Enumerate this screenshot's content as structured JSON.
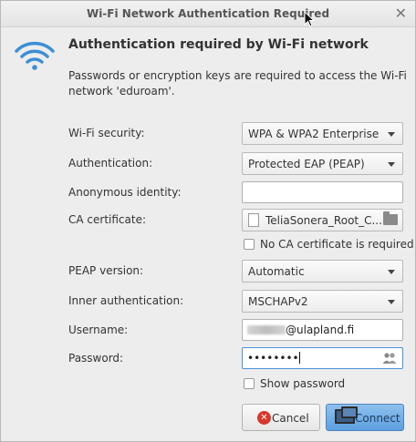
{
  "window": {
    "title": "Wi-Fi Network Authentication Required"
  },
  "header": {
    "heading": "Authentication required by Wi-Fi network",
    "description": "Passwords or encryption keys are required to access the Wi-Fi network 'eduroam'."
  },
  "form": {
    "wifi_security": {
      "label": "Wi-Fi security:",
      "value": "WPA & WPA2 Enterprise"
    },
    "authentication": {
      "label": "Authentication:",
      "value": "Protected EAP (PEAP)"
    },
    "anonymous_identity": {
      "label": "Anonymous identity:",
      "value": ""
    },
    "ca_certificate": {
      "label": "CA certificate:",
      "value": "TeliaSonera_Root_C..."
    },
    "no_ca_required": {
      "label": "No CA certificate is required",
      "checked": false
    },
    "peap_version": {
      "label": "PEAP version:",
      "value": "Automatic"
    },
    "inner_authentication": {
      "label": "Inner authentication:",
      "value": "MSCHAPv2"
    },
    "username": {
      "label": "Username:",
      "value_suffix": "@ulapland.fi"
    },
    "password": {
      "label": "Password:",
      "value": "••••••••"
    },
    "show_password": {
      "label": "Show password",
      "checked": false
    }
  },
  "buttons": {
    "cancel": "Cancel",
    "connect": "Connect"
  },
  "icons": {
    "wifi": "wifi-icon",
    "close": "close-icon",
    "users": "users-icon",
    "folder": "folder-icon"
  },
  "colors": {
    "accent": "#4a90d9",
    "wifi": "#3b8fd6",
    "cancel": "#d8382c"
  }
}
